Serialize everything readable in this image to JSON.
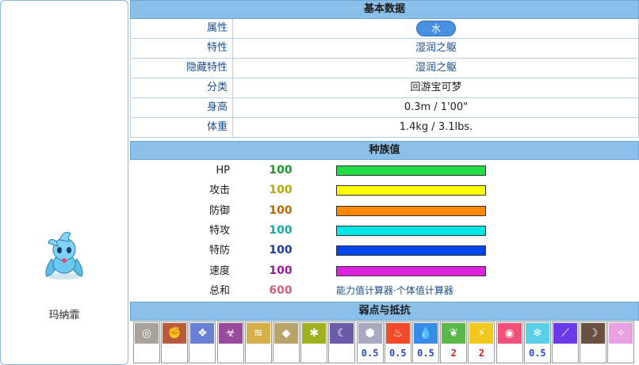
{
  "pokemon": {
    "name": "玛纳霏"
  },
  "basic": {
    "header": "基本数据",
    "rows": [
      {
        "label": "属性",
        "value": "水"
      },
      {
        "label": "特性",
        "value": "湿润之躯"
      },
      {
        "label": "隐藏特性",
        "value": "湿润之躯"
      },
      {
        "label": "分类",
        "value": "回游宝可梦"
      },
      {
        "label": "身高",
        "value": "0.3m / 1'00\""
      },
      {
        "label": "体重",
        "value": "1.4kg / 3.1lbs."
      }
    ],
    "type_color": "#4a90e2"
  },
  "stats": {
    "header": "种族值",
    "items": [
      {
        "label": "HP",
        "value": "100",
        "color": "#22dd44",
        "num_color": "#1a9a2a",
        "fraction": 1.0
      },
      {
        "label": "攻击",
        "value": "100",
        "color": "#ffff00",
        "num_color": "#b5a800",
        "fraction": 1.0
      },
      {
        "label": "防御",
        "value": "100",
        "color": "#ff8800",
        "num_color": "#b86a00",
        "fraction": 1.0
      },
      {
        "label": "特攻",
        "value": "100",
        "color": "#00e5e5",
        "num_color": "#16a8b0",
        "fraction": 1.0
      },
      {
        "label": "特防",
        "value": "100",
        "color": "#0044ee",
        "num_color": "#1a3aa0",
        "fraction": 1.0
      },
      {
        "label": "速度",
        "value": "100",
        "color": "#dd22dd",
        "num_color": "#a018a0",
        "fraction": 1.0
      }
    ],
    "total": {
      "label": "总和",
      "value": "600",
      "num_color": "#d06080"
    },
    "calculator_links": "能力值计算器·个体值计算器"
  },
  "weakness": {
    "header": "弱点与抵抗",
    "types": [
      {
        "icon": "normal-type-icon",
        "color": "#a8a29a",
        "value": ""
      },
      {
        "icon": "fighting-type-icon",
        "color": "#b85a3e",
        "value": ""
      },
      {
        "icon": "flying-type-icon",
        "color": "#6a7fd6",
        "value": ""
      },
      {
        "icon": "poison-type-icon",
        "color": "#9a4a9a",
        "value": ""
      },
      {
        "icon": "ground-type-icon",
        "color": "#d6ae4a",
        "value": ""
      },
      {
        "icon": "rock-type-icon",
        "color": "#b8a468",
        "value": ""
      },
      {
        "icon": "bug-type-icon",
        "color": "#a0b020",
        "value": ""
      },
      {
        "icon": "ghost-type-icon",
        "color": "#6a5aa8",
        "value": ""
      },
      {
        "icon": "steel-type-icon",
        "color": "#a8a8c0",
        "value": "0.5",
        "val_color": "#2a4ac0"
      },
      {
        "icon": "fire-type-icon",
        "color": "#f04a2a",
        "value": "0.5",
        "val_color": "#2a4ac0"
      },
      {
        "icon": "water-type-icon",
        "color": "#3a8ae8",
        "value": "0.5",
        "val_color": "#2a4ac0"
      },
      {
        "icon": "grass-type-icon",
        "color": "#5ab84a",
        "value": "2",
        "val_color": "#d02020"
      },
      {
        "icon": "electric-type-icon",
        "color": "#f0c820",
        "value": "2",
        "val_color": "#d02020"
      },
      {
        "icon": "psychic-type-icon",
        "color": "#f0507a",
        "value": ""
      },
      {
        "icon": "ice-type-icon",
        "color": "#5ad0e8",
        "value": "0.5",
        "val_color": "#2a4ac0"
      },
      {
        "icon": "dragon-type-icon",
        "color": "#6a3ae8",
        "value": ""
      },
      {
        "icon": "dark-type-icon",
        "color": "#6a5040",
        "value": ""
      },
      {
        "icon": "fairy-type-icon",
        "color": "#e8a0e0",
        "value": ""
      }
    ]
  }
}
